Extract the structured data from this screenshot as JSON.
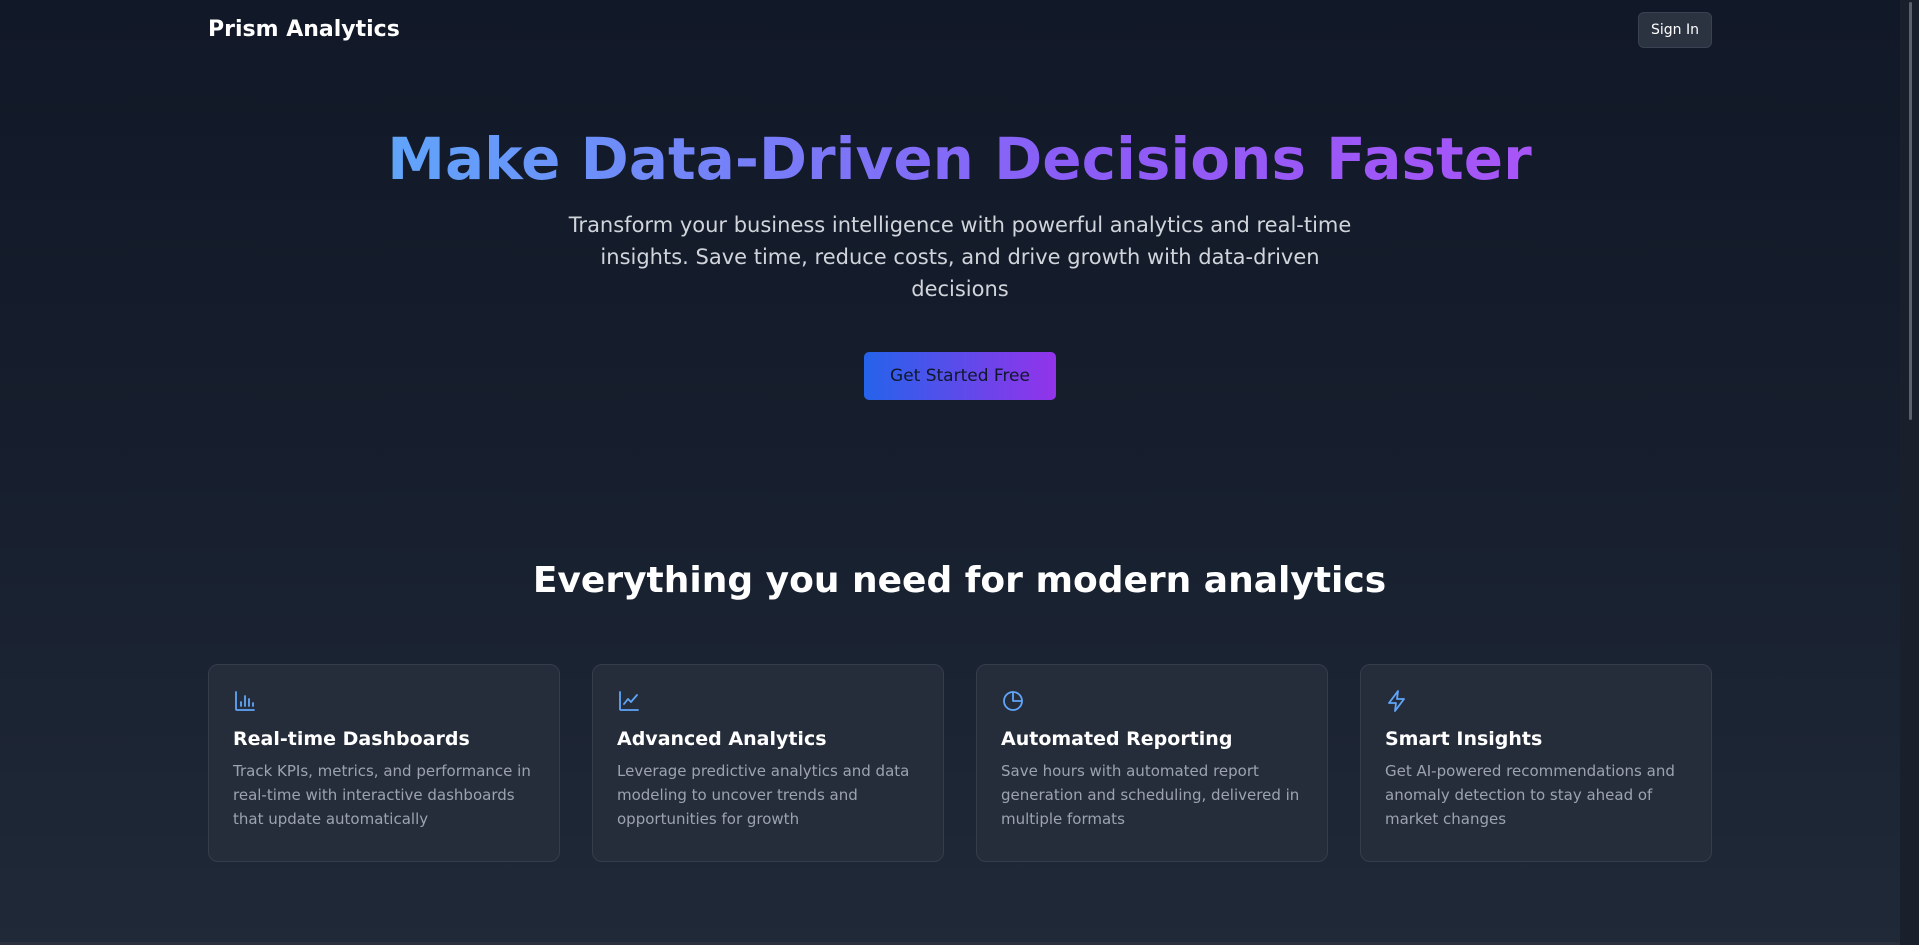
{
  "nav": {
    "brand": "Prism Analytics",
    "signin_label": "Sign In"
  },
  "hero": {
    "title": "Make Data-Driven Decisions Faster",
    "subtitle": "Transform your business intelligence with powerful analytics and real-time insights. Save time, reduce costs, and drive growth with data-driven decisions",
    "cta_label": "Get Started Free"
  },
  "features": {
    "heading": "Everything you need for modern analytics",
    "items": [
      {
        "icon": "bar-chart-icon",
        "title": "Real-time Dashboards",
        "description": "Track KPIs, metrics, and performance in real-time with interactive dashboards that update automatically"
      },
      {
        "icon": "line-chart-icon",
        "title": "Advanced Analytics",
        "description": "Leverage predictive analytics and data modeling to uncover trends and opportunities for growth"
      },
      {
        "icon": "pie-chart-icon",
        "title": "Automated Reporting",
        "description": "Save hours with automated report generation and scheduling, delivered in multiple formats"
      },
      {
        "icon": "lightning-icon",
        "title": "Smart Insights",
        "description": "Get AI-powered recommendations and anomaly detection to stay ahead of market changes"
      }
    ]
  },
  "colors": {
    "background": "#111827",
    "card": "#252d3a",
    "accent_blue": "#60a5fa",
    "accent_purple": "#a855f7",
    "muted_text": "#9ca3af"
  }
}
